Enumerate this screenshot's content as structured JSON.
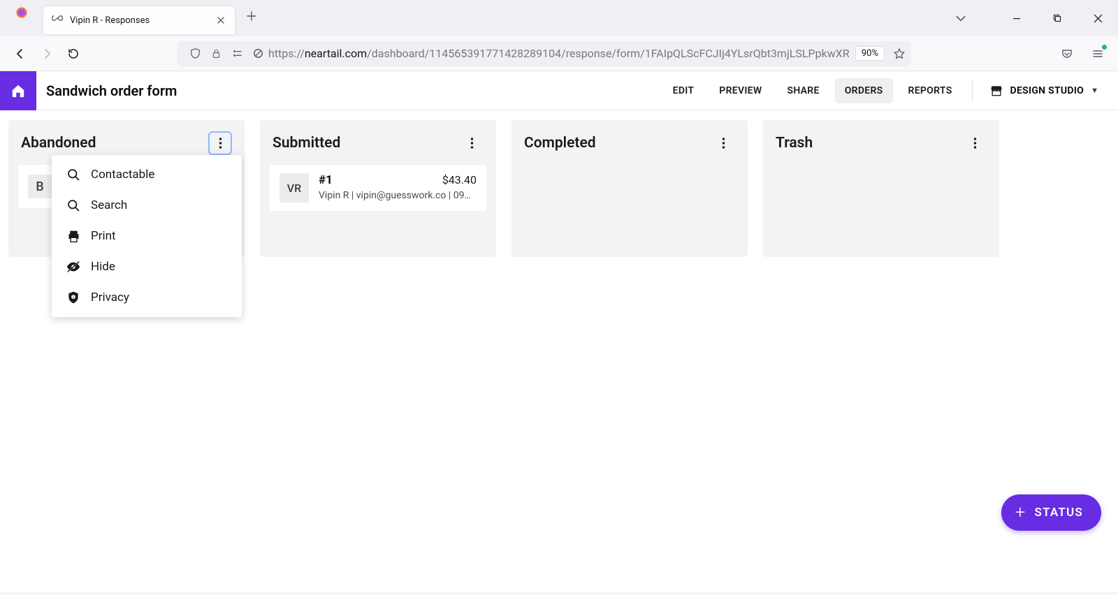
{
  "browser": {
    "tab_title": "Vipin R - Responses",
    "url_host": "neartail.com",
    "url_scheme": "https://",
    "url_path": "/dashboard/114565391771428289104/response/form/1FAIpQLScFCJIj4YLsrQbt3mjLSLPpkwXR",
    "zoom": "90%"
  },
  "app": {
    "title": "Sandwich order form",
    "nav": {
      "edit": "EDIT",
      "preview": "PREVIEW",
      "share": "SHARE",
      "orders": "ORDERS",
      "reports": "REPORTS"
    },
    "studio": "DESIGN STUDIO"
  },
  "columns": {
    "abandoned": {
      "title": "Abandoned",
      "card_avatar": "B"
    },
    "submitted": {
      "title": "Submitted",
      "card": {
        "avatar": "VR",
        "id": "#1",
        "amount": "$43.40",
        "sub": "Vipin R | vipin@guesswork.co | 09…"
      }
    },
    "completed": {
      "title": "Completed"
    },
    "trash": {
      "title": "Trash"
    }
  },
  "popover": {
    "contactable": "Contactable",
    "search": "Search",
    "print": "Print",
    "hide": "Hide",
    "privacy": "Privacy"
  },
  "fab": {
    "label": "STATUS"
  }
}
